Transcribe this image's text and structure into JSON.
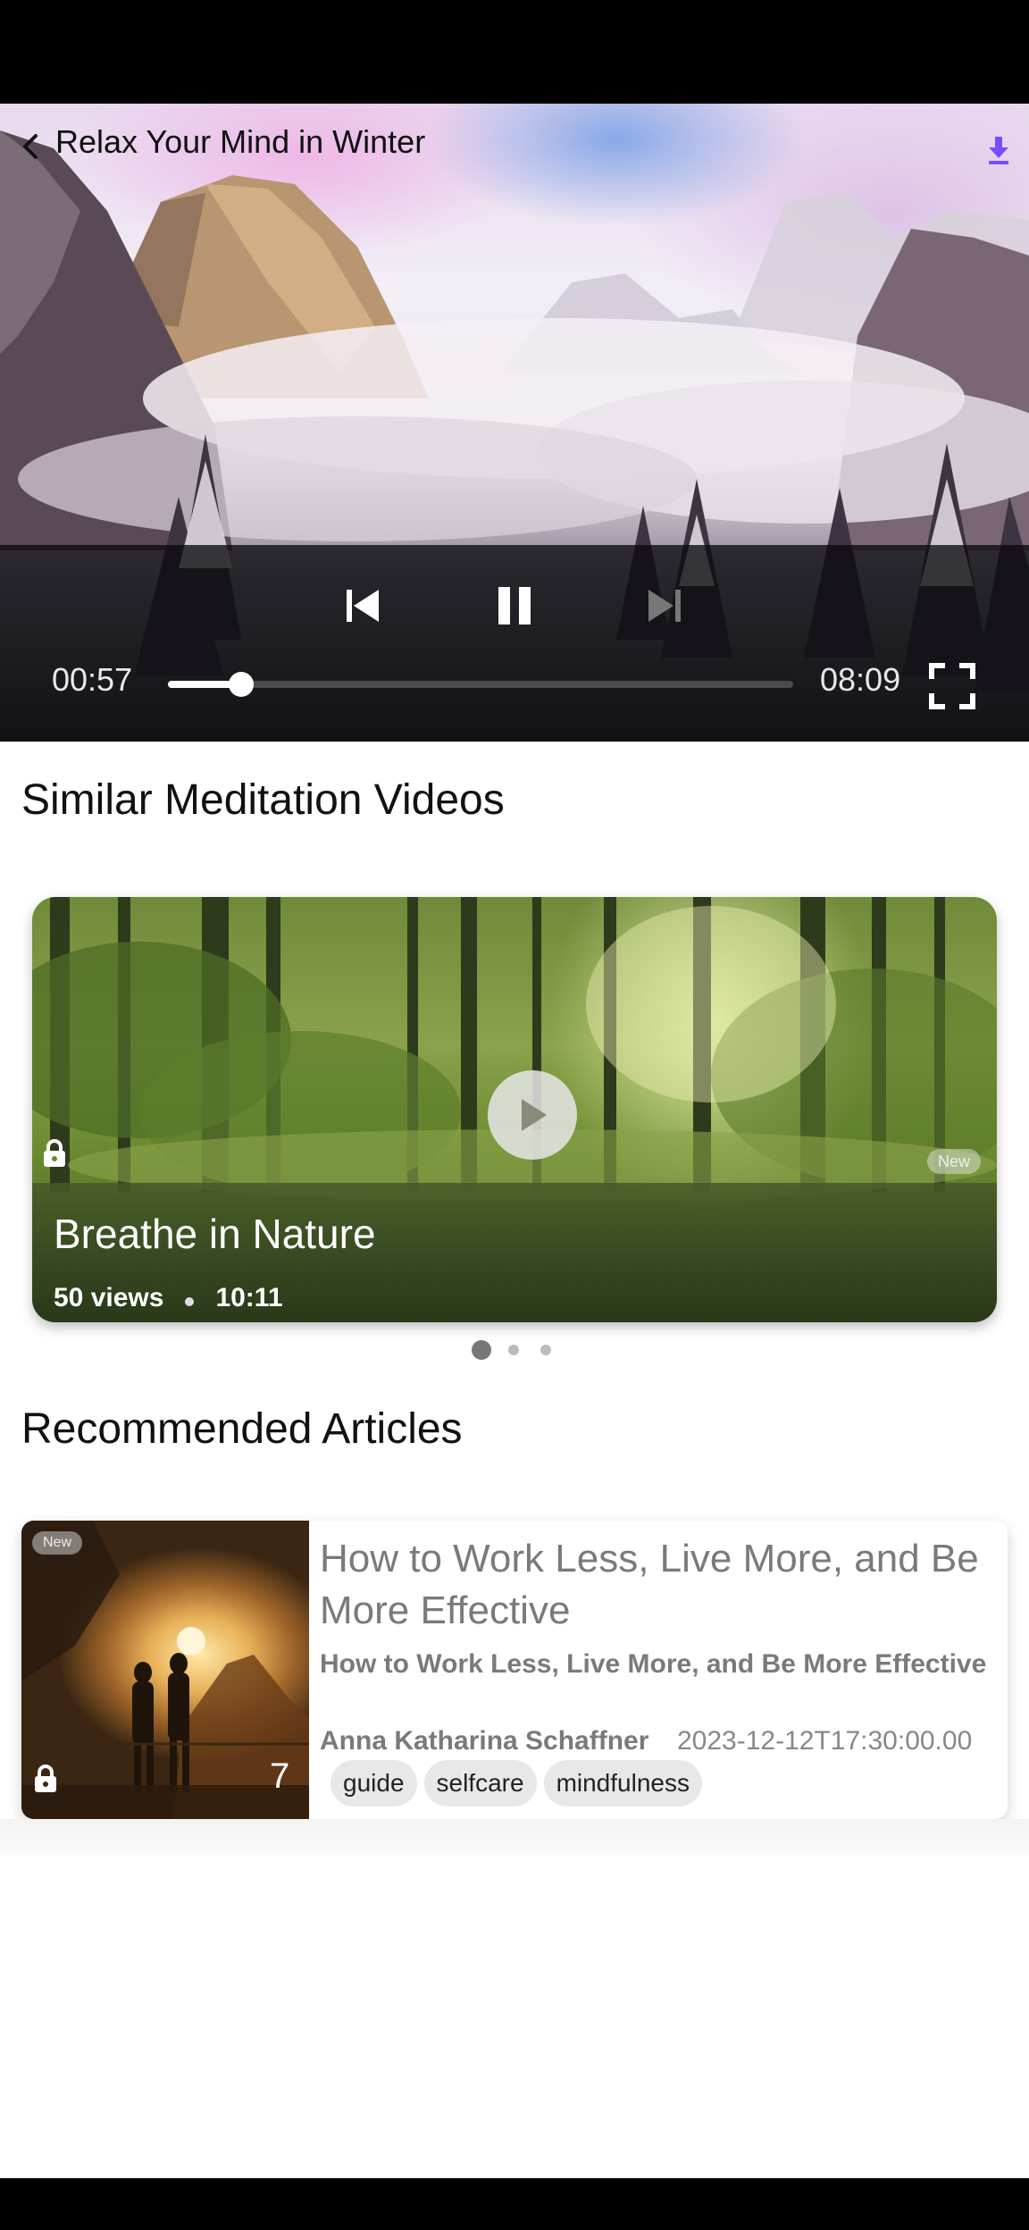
{
  "player": {
    "title": "Relax Your Mind in Winter",
    "current_time": "00:57",
    "total_time": "08:09",
    "progress_fraction": 0.117,
    "icons": {
      "back": "chevron-left-icon",
      "download": "download-icon",
      "previous": "skip-previous-icon",
      "pause": "pause-icon",
      "next": "skip-next-icon",
      "fullscreen": "fullscreen-icon"
    },
    "accent_color": "#7c4dff"
  },
  "similar_videos": {
    "heading": "Similar Meditation Videos",
    "cards": [
      {
        "title": "Breathe in Nature",
        "views": "50 views",
        "duration": "10:11",
        "badge": "New",
        "locked": true
      }
    ],
    "pager": {
      "count": 3,
      "active_index": 0
    }
  },
  "recommended_articles": {
    "heading": "Recommended Articles",
    "items": [
      {
        "title": "How to Work Less, Live More, and Be More Effective",
        "subtitle": "How to Work Less, Live More, and Be More Effective",
        "author": "Anna Katharina Schaffner",
        "date": "2023-12-12T17:30:00.00",
        "count": "7",
        "badge": "New",
        "locked": true,
        "tags": [
          "guide",
          "selfcare",
          "mindfulness"
        ]
      }
    ]
  }
}
